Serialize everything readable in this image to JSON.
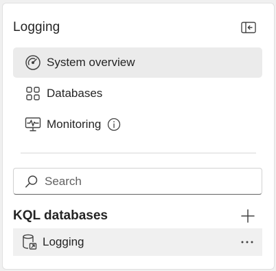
{
  "panel": {
    "title": "Logging"
  },
  "nav": {
    "items": [
      {
        "label": "System overview",
        "icon": "gauge-icon",
        "active": true
      },
      {
        "label": "Databases",
        "icon": "grid-icon",
        "active": false
      },
      {
        "label": "Monitoring",
        "icon": "monitor-pulse-icon",
        "active": false
      }
    ]
  },
  "search": {
    "placeholder": "Search",
    "value": ""
  },
  "kql": {
    "section_title": "KQL databases",
    "databases": [
      {
        "label": "Logging",
        "icon": "database-icon"
      }
    ]
  },
  "colors": {
    "active_bg": "#ebebeb",
    "row_bg": "#f0f0f0",
    "text": "#242424",
    "icon": "#424242"
  }
}
